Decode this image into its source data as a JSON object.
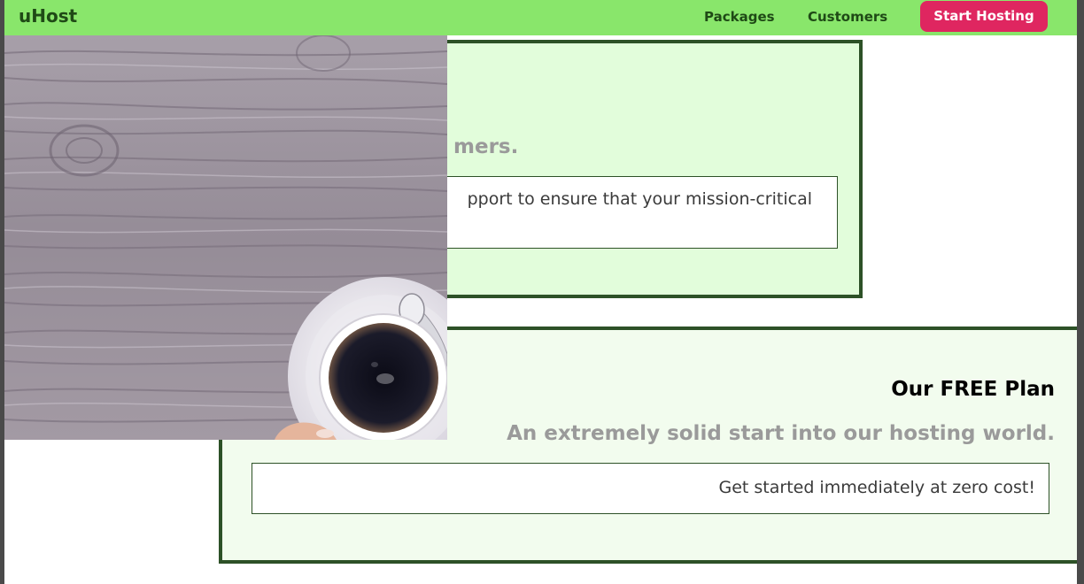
{
  "header": {
    "brand": "uHost",
    "nav": [
      {
        "label": "Packages"
      },
      {
        "label": "Customers"
      }
    ],
    "cta_label": "Start Hosting"
  },
  "cards": [
    {
      "title": "",
      "subtitle": "mers.",
      "description": "pport to ensure that your mission-critical"
    },
    {
      "title": "Our FREE Plan",
      "subtitle": "An extremely solid start into our hosting world.",
      "description": "Get started immediately at zero cost!"
    }
  ],
  "hero_image": {
    "description": "coffee-cup-on-wood-table"
  },
  "colors": {
    "header_bg": "#89e66b",
    "brand_text": "#1f4a16",
    "cta_bg": "#df2660",
    "card_border": "#2d5127",
    "card_1_bg": "#e2fddb",
    "card_2_bg": "#f2fcee",
    "subtitle_text": "#9a9a9a"
  }
}
